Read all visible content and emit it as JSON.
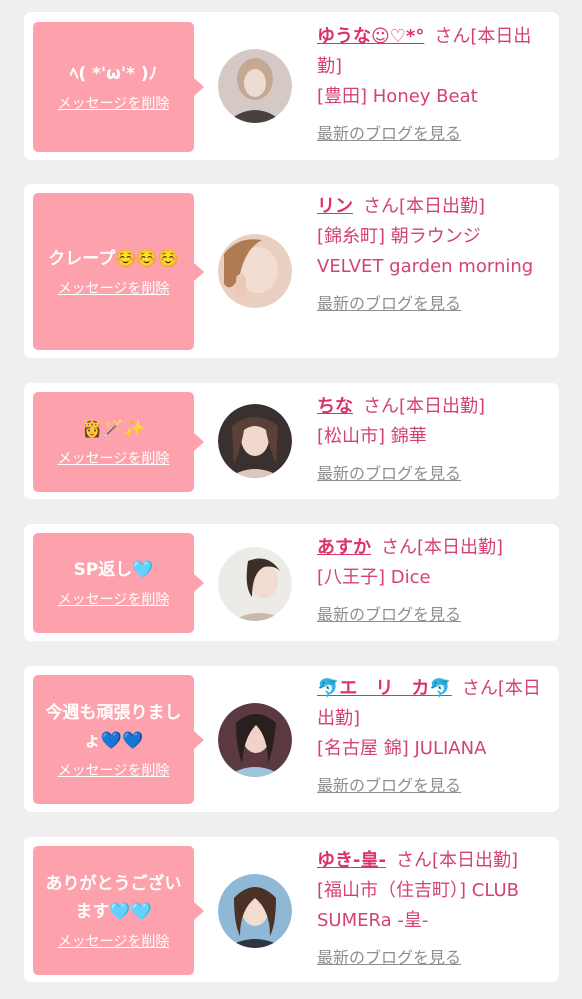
{
  "ui": {
    "delete_label": "メッセージを削除",
    "blog_label": "最新のブログを見る",
    "san_suffix": "さん",
    "shift_label": "[本日出勤]"
  },
  "colors": {
    "page_background": "#f0eff0",
    "card_background": "#ffffff",
    "bubble": "#fda2ad",
    "accent_name": "#dc3266",
    "accent_text": "#d44370",
    "link_grey": "#8e8e8e"
  },
  "messages": [
    {
      "message": "ﾍ( *'ω'* )ﾉ",
      "name": "ゆうな☺︎♡*°",
      "location": "[豊田] Honey Beat",
      "avatar_icon": "avatar-photo"
    },
    {
      "message": "クレープ☺️☺️☺️",
      "name": "リン",
      "location": "[錦糸町] 朝ラウンジ VELVET garden morning",
      "avatar_icon": "avatar-photo"
    },
    {
      "message": "👸🪄✨",
      "name": "ちな",
      "location": "[松山市] 錦華",
      "avatar_icon": "avatar-photo"
    },
    {
      "message": "SP返し🩵",
      "name": "あすか",
      "location": "[八王子] Dice",
      "avatar_icon": "avatar-photo"
    },
    {
      "message": "今週も頑張りましょ💙💙",
      "name": "🐬エ　リ　カ🐬",
      "location": "[名古屋 錦] JULIANA",
      "avatar_icon": "avatar-photo"
    },
    {
      "message": "ありがとうございます🩵🩵",
      "name": "ゆき-皇-",
      "location": "[福山市（住吉町）] CLUB SUMERa -皇-",
      "avatar_icon": "avatar-photo"
    }
  ]
}
